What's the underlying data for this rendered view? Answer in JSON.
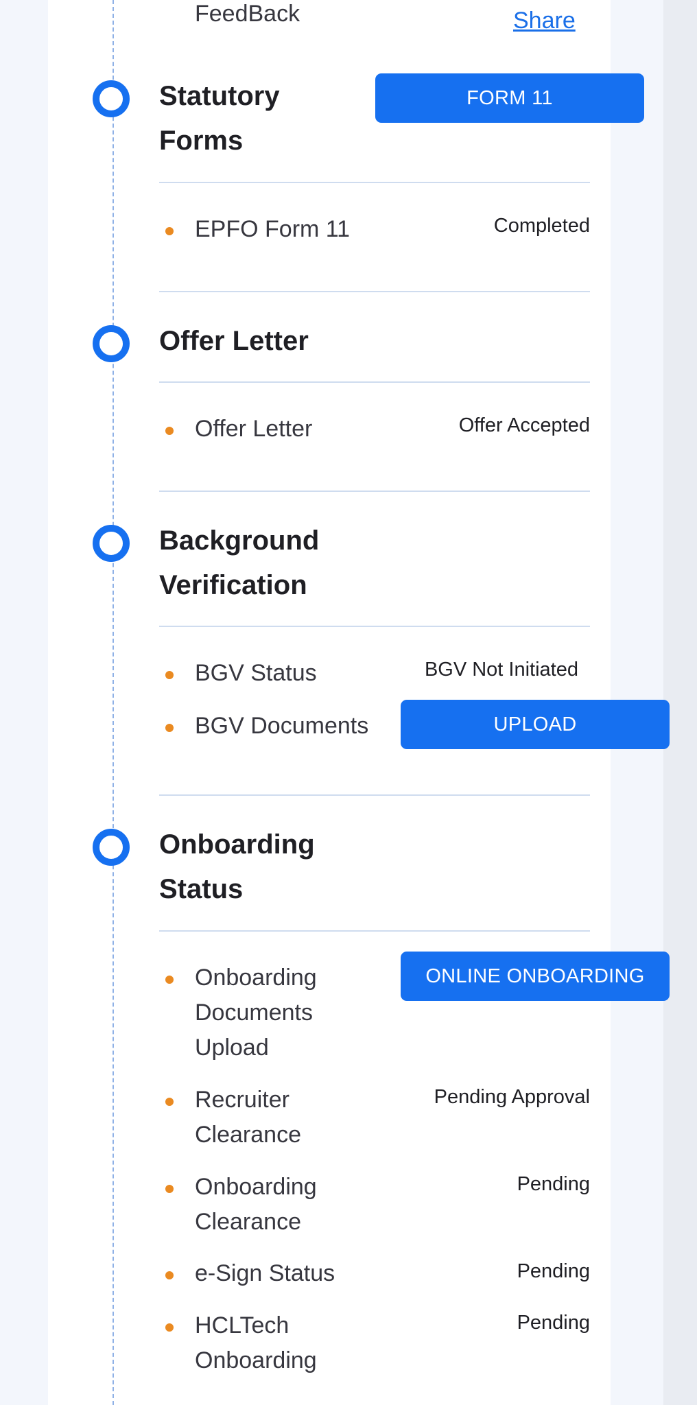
{
  "top": {
    "feedback_text": "FeedBack",
    "share_link": "Share"
  },
  "sections": [
    {
      "title": "Statutory Forms",
      "action_button": "FORM 11",
      "items": [
        {
          "label": "EPFO Form 11",
          "status": "Completed"
        }
      ]
    },
    {
      "title": "Offer Letter",
      "items": [
        {
          "label": "Offer Letter",
          "status": "Offer Accepted"
        }
      ]
    },
    {
      "title": "Background Verification",
      "items": [
        {
          "label": "BGV Status",
          "status": "BGV Not Initiated"
        },
        {
          "label": "BGV Documents",
          "action_button": "UPLOAD"
        }
      ]
    },
    {
      "title": "Onboarding Status",
      "items": [
        {
          "label": "Onboarding Documents Upload",
          "action_button": "ONLINE ONBOARDING"
        },
        {
          "label": "Recruiter Clearance",
          "status": "Pending Approval"
        },
        {
          "label": "Onboarding Clearance",
          "status": "Pending"
        },
        {
          "label": "e-Sign Status",
          "status": "Pending"
        },
        {
          "label": "HCLTech Onboarding",
          "status": "Pending"
        }
      ]
    }
  ],
  "colors": {
    "accent": "#1670f0",
    "bullet": "#ea8a21",
    "divider": "#cfdcef",
    "page_background": "#f3f6fc",
    "card_background": "#ffffff"
  }
}
